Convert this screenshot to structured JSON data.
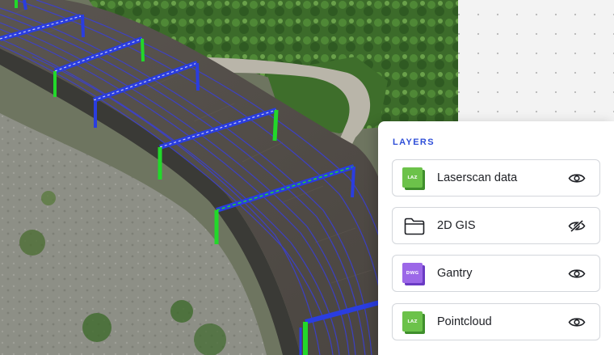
{
  "panel": {
    "title": "LAYERS"
  },
  "layers": [
    {
      "label": "Laserscan data",
      "icon": "laz-file-icon",
      "badge": "LAZ",
      "icon_color": "#6cc24a",
      "visibility": "visible",
      "visibility_icon": "eye-icon"
    },
    {
      "label": "2D GIS",
      "icon": "folder-icon",
      "visibility": "hidden",
      "visibility_icon": "eye-off-icon"
    },
    {
      "label": "Gantry",
      "icon": "dwg-file-icon",
      "badge": "DWG",
      "icon_color": "#9c68e8",
      "visibility": "visible",
      "visibility_icon": "eye-icon"
    },
    {
      "label": "Pointcloud",
      "icon": "laz-file-icon",
      "badge": "LAZ",
      "icon_color": "#6cc24a",
      "visibility": "visible",
      "visibility_icon": "eye-icon"
    }
  ],
  "colors": {
    "accent": "#2f4fd8",
    "gantry_blue": "#2a3de0",
    "gantry_green": "#22d82a"
  }
}
